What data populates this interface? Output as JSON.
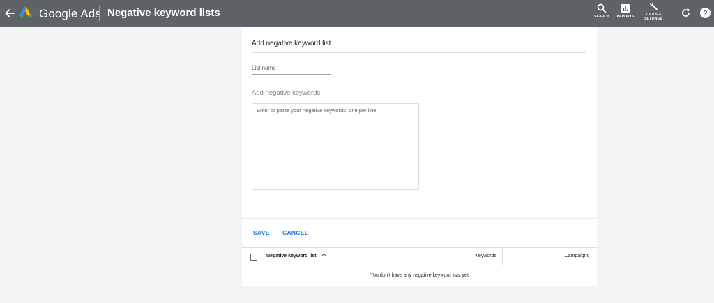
{
  "header": {
    "brand": "Google Ads",
    "page_title": "Negative keyword lists",
    "tools": {
      "search": "SEARCH",
      "reports": "REPORTS",
      "settings_line1": "TOOLS &",
      "settings_line2": "SETTINGS"
    },
    "icons": [
      "back-arrow-icon",
      "google-ads-logo",
      "search-icon",
      "reports-icon",
      "wrench-icon",
      "refresh-icon",
      "help-icon"
    ]
  },
  "form": {
    "title": "Add negative keyword list",
    "list_name_placeholder": "List name",
    "list_name_value": "",
    "keywords_heading": "Add negative keywords",
    "keywords_placeholder": "Enter or paste your negative keywords, one per line",
    "keywords_value": "",
    "save_label": "SAVE",
    "cancel_label": "CANCEL"
  },
  "table": {
    "columns": {
      "list": "Negative keyword list",
      "keywords": "Keywords",
      "campaigns": "Campaigns"
    },
    "empty_message": "You don't have any negative keyword lists yet"
  },
  "colors": {
    "topbar": "#5f6368",
    "accent": "#1a73e8",
    "background": "#f1f3f4"
  }
}
